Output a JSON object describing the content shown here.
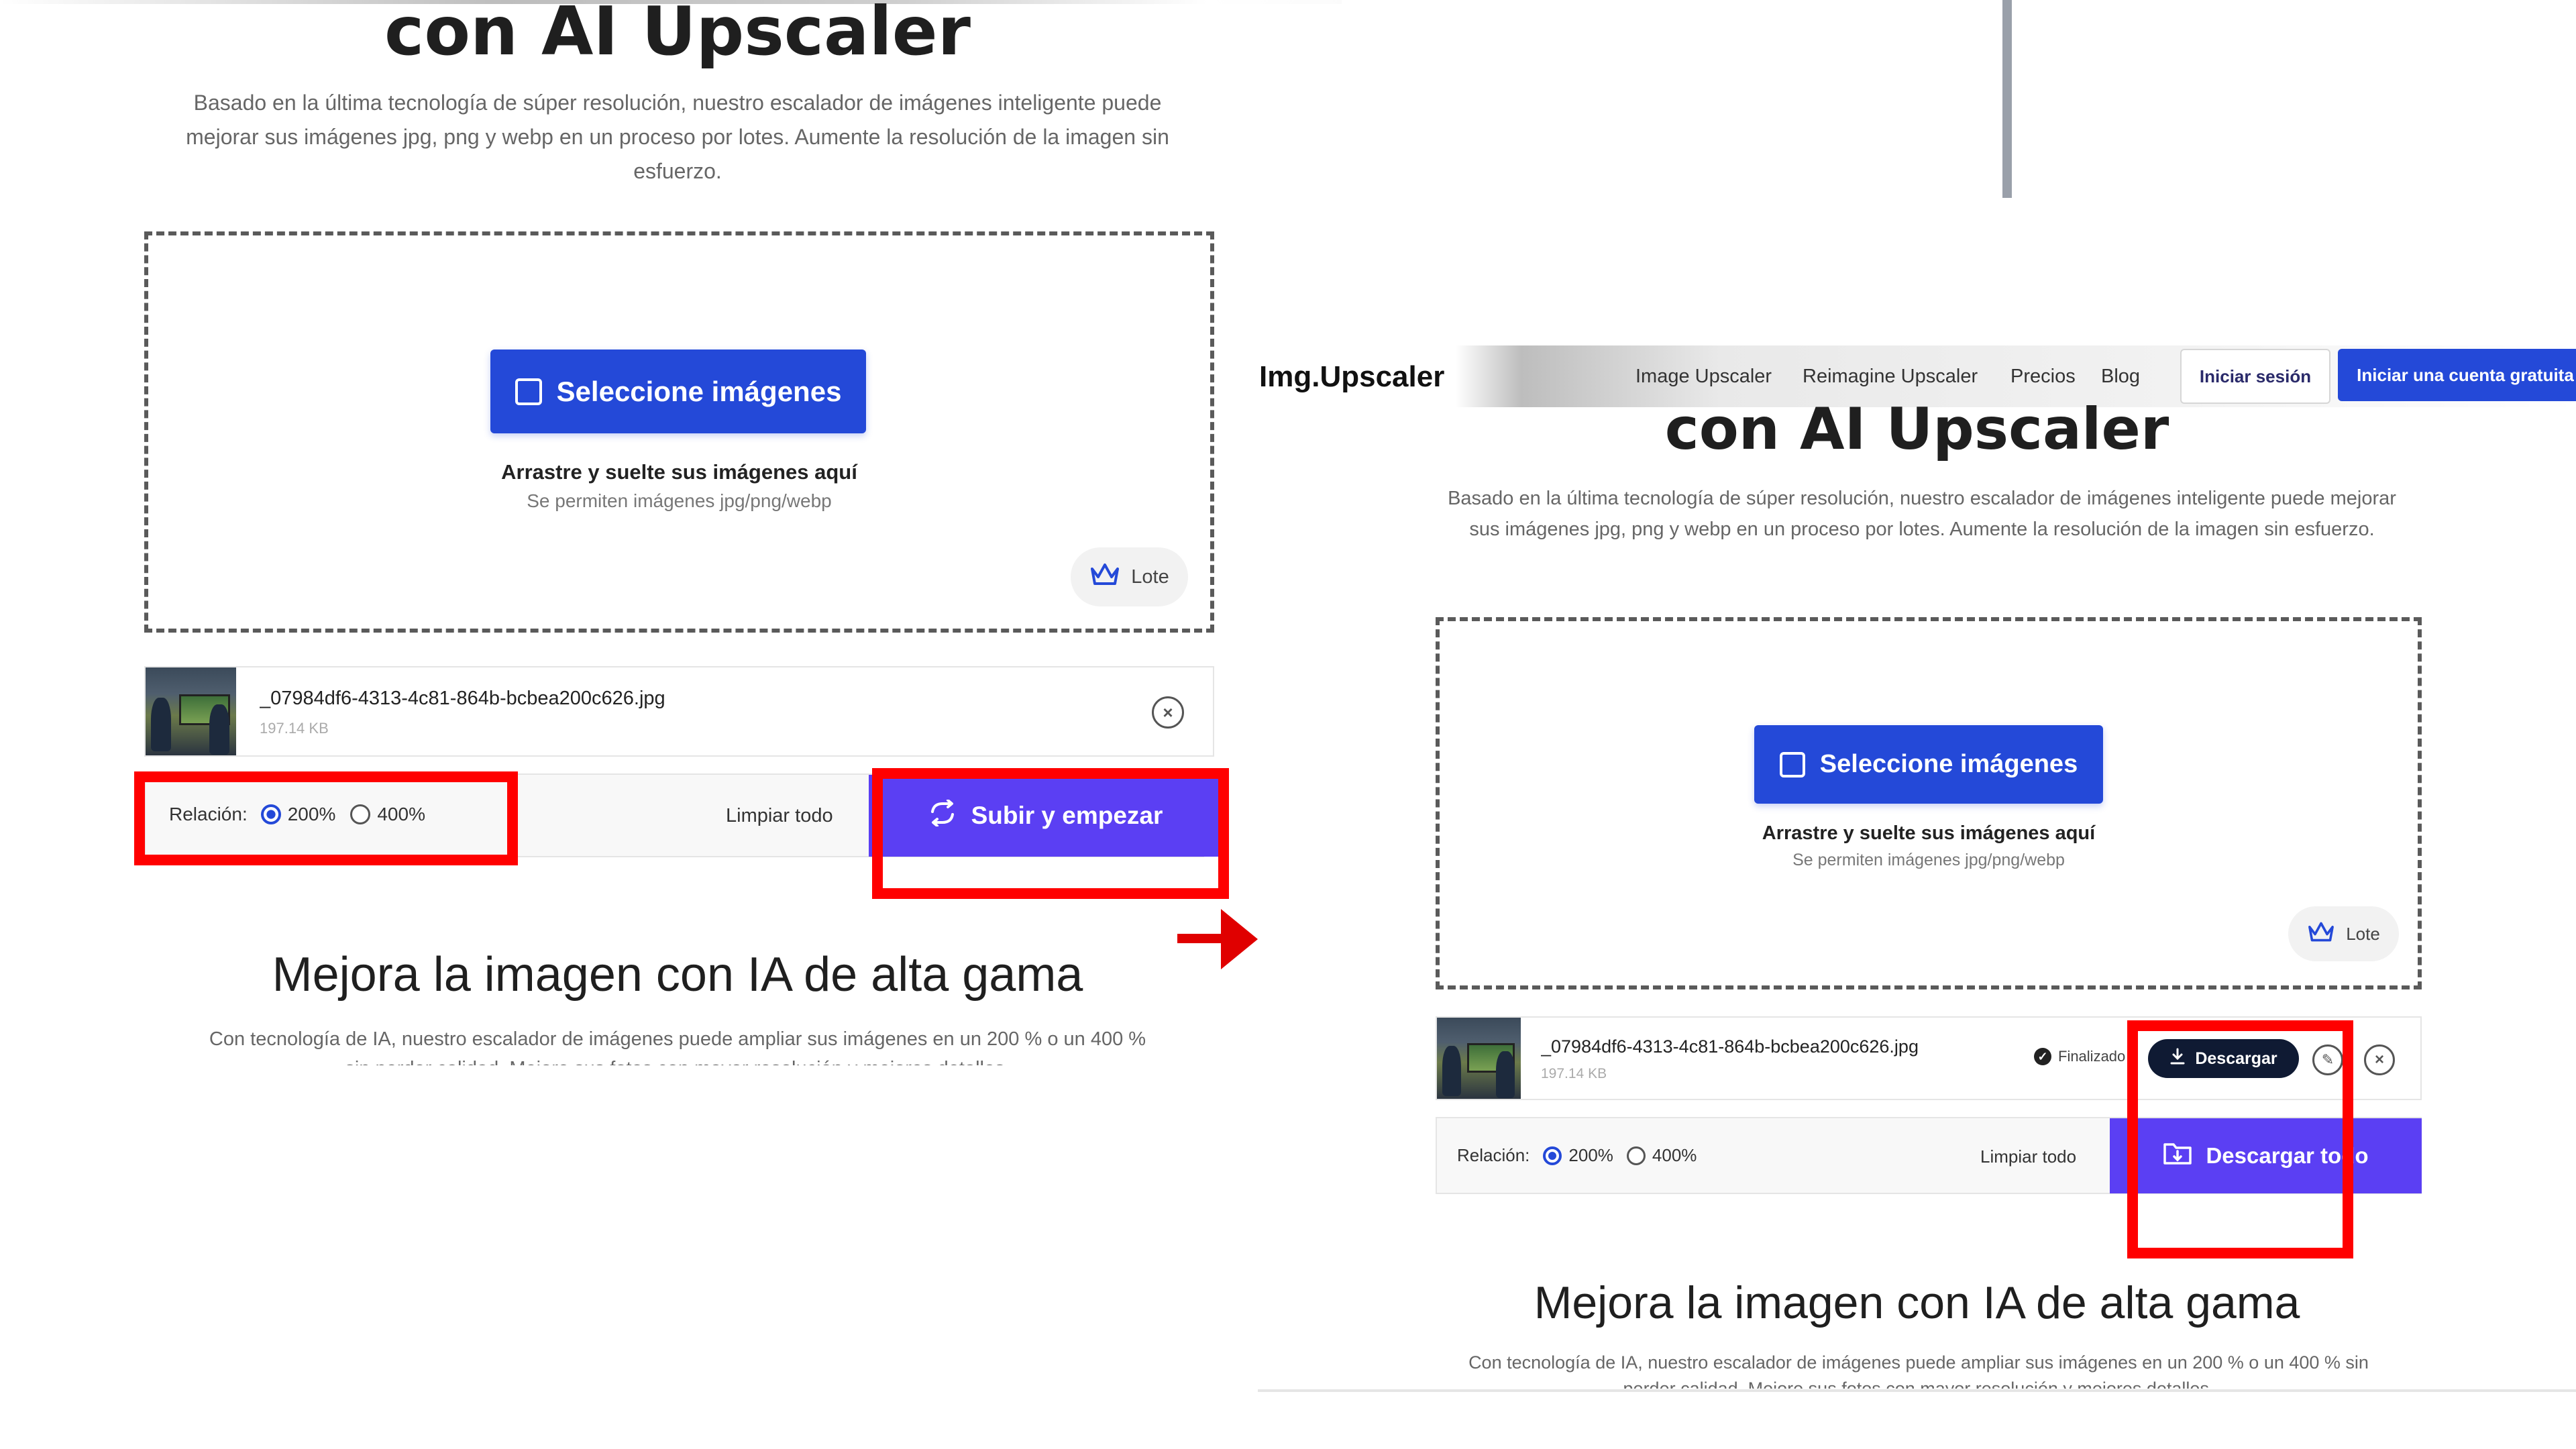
{
  "left": {
    "hero_title": "con AI Upscaler",
    "hero_desc": "Basado en la última tecnología de súper resolución, nuestro escalador de imágenes inteligente puede mejorar sus imágenes jpg, png y webp en un proceso por lotes. Aumente la resolución de la imagen sin esfuerzo.",
    "select_button": "Seleccione imágenes",
    "drag_title": "Arrastre y suelte sus imágenes aquí",
    "drag_sub": "Se permiten imágenes jpg/png/webp",
    "lote": "Lote",
    "file": {
      "name": "_07984df6-4313-4c81-864b-bcbea200c626.jpg",
      "size": "197.14 KB"
    },
    "ratio_label": "Relación:",
    "ratio_options": [
      "200%",
      "400%"
    ],
    "ratio_selected": "200%",
    "clear_all": "Limpiar todo",
    "start_button": "Subir y empezar",
    "section_title": "Mejora la imagen con IA de alta gama",
    "section_desc": "Con tecnología de IA, nuestro escalador de imágenes puede ampliar sus imágenes en un 200 % o un 400 % sin perder calidad. Mejore sus fotos con mayor resolución y mejores detalles."
  },
  "right": {
    "nav": {
      "logo": "Img.Upscaler",
      "links": [
        "Image Upscaler",
        "Reimagine Upscaler",
        "Precios",
        "Blog"
      ],
      "login": "Iniciar sesión",
      "signup": "Iniciar una cuenta gratuita"
    },
    "hero_title": "con AI Upscaler",
    "hero_desc": "Basado en la última tecnología de súper resolución, nuestro escalador de imágenes inteligente puede mejorar sus imágenes jpg, png y webp en un proceso por lotes. Aumente la resolución de la imagen sin esfuerzo.",
    "select_button": "Seleccione imágenes",
    "drag_title": "Arrastre y suelte sus imágenes aquí",
    "drag_sub": "Se permiten imágenes jpg/png/webp",
    "lote": "Lote",
    "file": {
      "name": "_07984df6-4313-4c81-864b-bcbea200c626.jpg",
      "size": "197.14 KB",
      "status": "Finalizado"
    },
    "download_button": "Descargar",
    "ratio_label": "Relación:",
    "ratio_options": [
      "200%",
      "400%"
    ],
    "ratio_selected": "200%",
    "clear_all": "Limpiar todo",
    "download_all_button": "Descargar todo",
    "section_title": "Mejora la imagen con IA de alta gama",
    "section_desc": "Con tecnología de IA, nuestro escalador de imágenes puede ampliar sus imágenes en un 200 % o un 400 % sin perder calidad. Mejore sus fotos con mayor resolución y mejores detalles."
  },
  "colors": {
    "primary_blue": "#2449d8",
    "purple": "#5b3ff3",
    "highlight_red": "#ff0000",
    "dark_button": "#0f1a33"
  }
}
